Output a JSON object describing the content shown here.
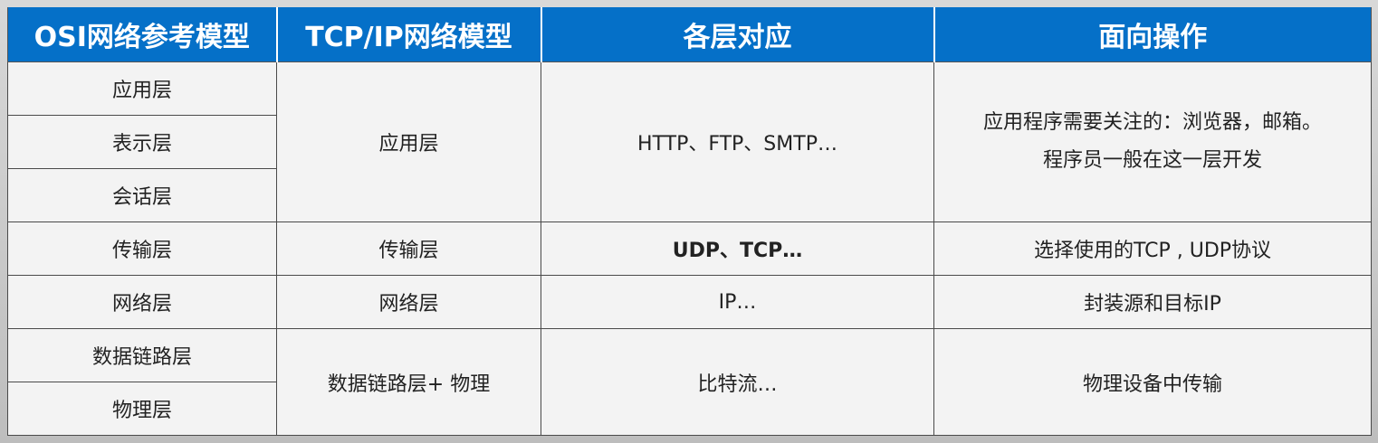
{
  "headers": [
    "OSI网络参考模型",
    "TCP/IP网络模型",
    "各层对应",
    "面向操作"
  ],
  "osi_layers": [
    "应用层",
    "表示层",
    "会话层",
    "传输层",
    "网络层",
    "数据链路层",
    "物理层"
  ],
  "tcpip_layers": [
    "应用层",
    "传输层",
    "网络层",
    "数据链路层+ 物理"
  ],
  "protocols": [
    "HTTP、FTP、SMTP…",
    "UDP、TCP…",
    "IP…",
    "比特流…"
  ],
  "operations": {
    "application": [
      "应用程序需要关注的：浏览器，邮箱。",
      "程序员一般在这一层开发"
    ],
    "transport": "选择使用的TCP , UDP协议",
    "network": "封装源和目标IP",
    "link_physical": "物理设备中传输"
  },
  "colors": {
    "header_bg": "#0570c8",
    "header_text": "#ffffff",
    "highlight_red": "#d42a1c",
    "cell_bg": "#f3f3f3"
  }
}
